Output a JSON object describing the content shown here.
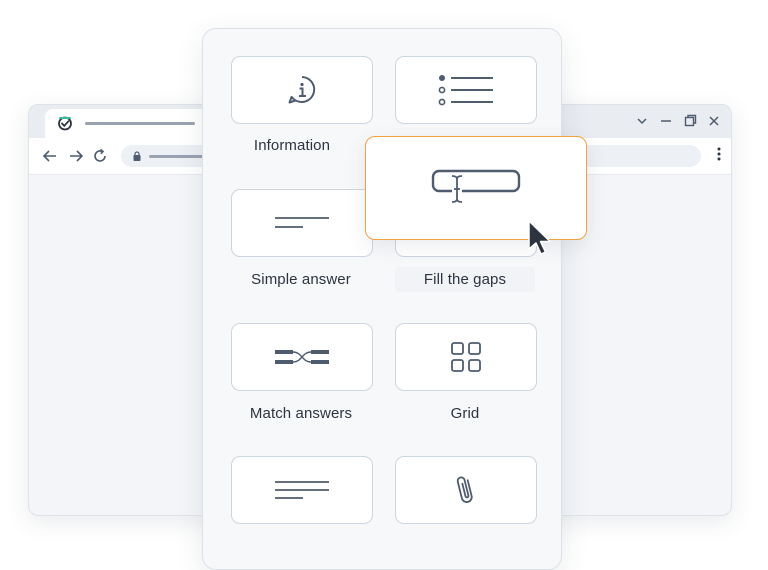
{
  "browser": {
    "favicon": "check-badge-icon",
    "controls": [
      "chevron-down-icon",
      "minimize-icon",
      "restore-icon",
      "close-icon"
    ],
    "nav": [
      "back-arrow-icon",
      "forward-arrow-icon",
      "reload-icon"
    ]
  },
  "panel": {
    "items": [
      {
        "label": "Information",
        "icon": "info-bubble-icon"
      },
      {
        "label": "",
        "icon": "bullet-list-icon"
      },
      {
        "label": "Simple answer",
        "icon": "short-lines-icon"
      },
      {
        "label": "Fill the gaps",
        "icon": "text-field-icon"
      },
      {
        "label": "Match answers",
        "icon": "match-connector-icon"
      },
      {
        "label": "Grid",
        "icon": "grid-icon"
      },
      {
        "label": "",
        "icon": "paragraph-lines-icon"
      },
      {
        "label": "",
        "icon": "paperclip-icon"
      }
    ]
  },
  "drag": {
    "icon": "text-field-cursor-icon",
    "cursor": "mouse-pointer-icon"
  },
  "colors": {
    "accent_orange": "#f2a140",
    "icon_slate": "#4f5b6e",
    "card_border": "#cfd5dd",
    "panel_bg": "#f7f8fa"
  }
}
